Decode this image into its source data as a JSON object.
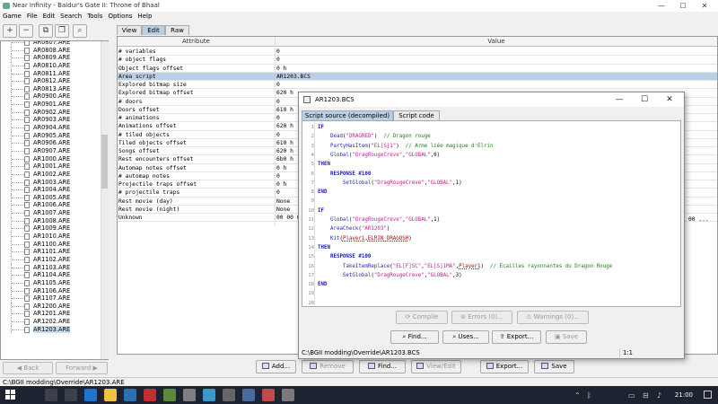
{
  "window": {
    "title": "Near Infinity - Baldur's Gate II: Throne of Bhaal",
    "controls": [
      "—",
      "☐",
      "✕"
    ]
  },
  "menu": [
    "Game",
    "File",
    "Edit",
    "Search",
    "Tools",
    "Options",
    "Help"
  ],
  "tree": {
    "items": [
      "AR0807.ARE",
      "AR0808.ARE",
      "AR0809.ARE",
      "AR0810.ARE",
      "AR0811.ARE",
      "AR0812.ARE",
      "AR0813.ARE",
      "AR0900.ARE",
      "AR0901.ARE",
      "AR0902.ARE",
      "AR0903.ARE",
      "AR0904.ARE",
      "AR0905.ARE",
      "AR0906.ARE",
      "AR0907.ARE",
      "AR1000.ARE",
      "AR1001.ARE",
      "AR1002.ARE",
      "AR1003.ARE",
      "AR1004.ARE",
      "AR1005.ARE",
      "AR1006.ARE",
      "AR1007.ARE",
      "AR1008.ARE",
      "AR1009.ARE",
      "AR1010.ARE",
      "AR1100.ARE",
      "AR1101.ARE",
      "AR1102.ARE",
      "AR1103.ARE",
      "AR1104.ARE",
      "AR1105.ARE",
      "AR1106.ARE",
      "AR1107.ARE",
      "AR1200.ARE",
      "AR1201.ARE",
      "AR1202.ARE",
      "AR1203.ARE"
    ],
    "selected_index": 37,
    "back_label": "Back",
    "forward_label": "Forward"
  },
  "tabs": [
    "View",
    "Edit",
    "Raw"
  ],
  "table": {
    "headers": [
      "Attribute",
      "Value"
    ],
    "rows": [
      [
        "# variables",
        "0"
      ],
      [
        "# object flags",
        "0"
      ],
      [
        "Object flags offset",
        "0 h"
      ],
      [
        "Area script",
        "AR1203.BCS"
      ],
      [
        "Explored bitmap size",
        "0"
      ],
      [
        "Explored bitmap offset",
        "620 h"
      ],
      [
        "# doors",
        "0"
      ],
      [
        "Doors offset",
        "610 h"
      ],
      [
        "# animations",
        "0"
      ],
      [
        "Animations offset",
        "620 h"
      ],
      [
        "# tiled objects",
        "0"
      ],
      [
        "Tiled objects offset",
        "610 h"
      ],
      [
        "Songs offset",
        "620 h"
      ],
      [
        "Rest encounters offset",
        "6b0 h"
      ],
      [
        "Automap notes offset",
        "0 h"
      ],
      [
        "# automap notes",
        "0"
      ],
      [
        "Projectile traps offset",
        "0 h"
      ],
      [
        "# projectile traps",
        "0"
      ],
      [
        "Rest movie (day)",
        "None"
      ],
      [
        "Rest movie (night)",
        "None"
      ],
      [
        "Unknown",
        "00 00 00"
      ]
    ],
    "selected_row": 3,
    "unknown_tail": "00 ..."
  },
  "bottom_buttons": [
    "Add...",
    "Remove",
    "Find...",
    "View/Edit",
    "Export...",
    "Save"
  ],
  "status_path": "C:\\BGII modding\\Override\\AR1203.ARE",
  "dialog": {
    "title": "AR1203.BCS",
    "tabs": [
      "Script source (decompiled)",
      "Script code"
    ],
    "lines": [
      [
        [
          "kw",
          "IF"
        ]
      ],
      [
        [
          "",
          "    "
        ],
        [
          "fn",
          "Dead"
        ],
        [
          "",
          "("
        ],
        [
          "st",
          "\"DRAGRED\""
        ],
        [
          "",
          ")  "
        ],
        [
          "cm",
          "// Dragon rouge"
        ]
      ],
      [
        [
          "",
          "    "
        ],
        [
          "fn",
          "PartyHasItem"
        ],
        [
          "",
          "("
        ],
        [
          "st",
          "\"EL[S]1\""
        ],
        [
          "",
          ")  "
        ],
        [
          "cm",
          "// Arme liée magique d'Elrin"
        ]
      ],
      [
        [
          "",
          "    "
        ],
        [
          "fn",
          "Global"
        ],
        [
          "",
          "("
        ],
        [
          "st",
          "\"DragRougeCreve\""
        ],
        [
          "",
          ","
        ],
        [
          "st",
          "\"GLOBAL\""
        ],
        [
          "",
          ",0)"
        ]
      ],
      [
        [
          "kw",
          "THEN"
        ]
      ],
      [
        [
          "",
          "    "
        ],
        [
          "kw",
          "RESPONSE #100"
        ]
      ],
      [
        [
          "",
          "        "
        ],
        [
          "fn",
          "SetGlobal"
        ],
        [
          "",
          "("
        ],
        [
          "st",
          "\"DragRougeCreve\""
        ],
        [
          "",
          ","
        ],
        [
          "st",
          "\"GLOBAL\""
        ],
        [
          "",
          ",1)"
        ]
      ],
      [
        [
          "kw",
          "END"
        ]
      ],
      [
        [
          "",
          ""
        ]
      ],
      [
        [
          "kw",
          "IF"
        ]
      ],
      [
        [
          "",
          "    "
        ],
        [
          "fn",
          "Global"
        ],
        [
          "",
          "("
        ],
        [
          "st",
          "\"DragRougeCreve\""
        ],
        [
          "",
          ","
        ],
        [
          "st",
          "\"GLOBAL\""
        ],
        [
          "",
          ",1)"
        ]
      ],
      [
        [
          "",
          "    "
        ],
        [
          "fn",
          "AreaCheck"
        ],
        [
          "",
          "("
        ],
        [
          "st",
          "\"AR1203\""
        ],
        [
          "",
          ")"
        ]
      ],
      [
        [
          "",
          "    "
        ],
        [
          "fn",
          "Kit"
        ],
        [
          "",
          "("
        ],
        [
          "ob",
          "Player1"
        ],
        [
          "",
          ","
        ],
        [
          "ob",
          "ELRIN_DRAGOSH"
        ],
        [
          "",
          ")"
        ]
      ],
      [
        [
          "kw",
          "THEN"
        ]
      ],
      [
        [
          "",
          "    "
        ],
        [
          "kw",
          "RESPONSE #100"
        ]
      ],
      [
        [
          "",
          "        "
        ],
        [
          "fn",
          "TakeItemReplace"
        ],
        [
          "",
          "("
        ],
        [
          "st",
          "\"EL[F]SC\""
        ],
        [
          "",
          ","
        ],
        [
          "st",
          "\"EL[S]1MA\""
        ],
        [
          "",
          ","
        ],
        [
          "ob",
          "Player1"
        ],
        [
          "",
          ")  "
        ],
        [
          "cm",
          "// Ecailles rayonnantes du Dragon Rouge"
        ]
      ],
      [
        [
          "",
          "        "
        ],
        [
          "fn",
          "SetGlobal"
        ],
        [
          "",
          "("
        ],
        [
          "st",
          "\"DragRougeCreve\""
        ],
        [
          "",
          ","
        ],
        [
          "st",
          "\"GLOBAL\""
        ],
        [
          "",
          ",3)"
        ]
      ],
      [
        [
          "kw",
          "END"
        ]
      ],
      [
        [
          "",
          ""
        ]
      ],
      [
        [
          "",
          ""
        ]
      ]
    ],
    "compile_buttons": [
      "Compile",
      "Errors (0)...",
      "Warnings (0)..."
    ],
    "file_buttons": [
      "Find...",
      "Uses...",
      "Export...",
      "Save"
    ],
    "path": "C:\\BGII modding\\Override\\AR1203.BCS",
    "position": "1:1"
  },
  "taskbar": {
    "clock": "21:00",
    "app_colors": [
      "#3a3f4a",
      "#3a3f4a",
      "#1e74d0",
      "#f0c040",
      "#2b6fb5",
      "#c03030",
      "#5a8a3a",
      "#808080",
      "#3a9ad0",
      "#666",
      "#4a6aa0",
      "#c04a4a",
      "#7a7a7a"
    ]
  }
}
